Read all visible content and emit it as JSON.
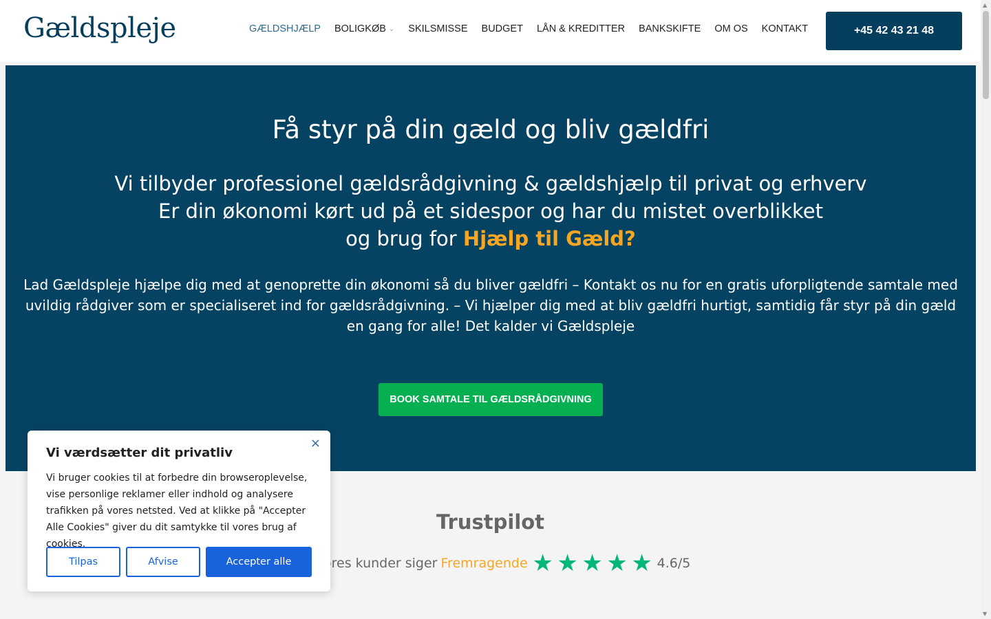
{
  "header": {
    "logo": "Gældspleje",
    "nav": [
      {
        "label": "GÆLDSHJÆLP",
        "active": true
      },
      {
        "label": "BOLIGKØB",
        "has_dropdown": true
      },
      {
        "label": "SKILSMISSE"
      },
      {
        "label": "BUDGET"
      },
      {
        "label": "LÅN & KREDITTER"
      },
      {
        "label": "BANKSKIFTE"
      },
      {
        "label": "OM OS"
      },
      {
        "label": "KONTAKT"
      }
    ],
    "phone": "+45 42 43 21 48"
  },
  "hero": {
    "title": "Få styr på din gæld og bliv gældfri",
    "sub_line1": "Vi tilbyder professionel gældsrådgivning & gældshjælp til privat og erhverv",
    "sub_line2": "Er din økonomi kørt ud på et sidespor og har du mistet overblikket",
    "sub_line3_prefix": "og brug for ",
    "sub_line3_highlight": "Hjælp til Gæld?",
    "body": "Lad Gældspleje hjælpe dig med at genoprette din økonomi så du bliver gældfri – Kontakt os nu for en gratis uforpligtende samtale med uvildig rådgiver som er specialiseret ind for gældsrådgivning. – Vi hjælper dig med at bliv gældfri hurtigt, samtidig får styr på din gæld en gang for alle! Det kalder vi Gældspleje",
    "cta": "BOOK SAMTALE TIL GÆLDSRÅDGIVNING"
  },
  "trustpilot": {
    "title": "Trustpilot",
    "lead": "ores kunder siger",
    "rating_word": "Fremragende",
    "stars": 5,
    "score": "4.6/5"
  },
  "cookie": {
    "title": "Vi værdsætter dit privatliv",
    "text": "Vi bruger cookies til at forbedre din browseroplevelse, vise personlige reklamer eller indhold og analysere trafikken på vores netsted. Ved at klikke på \"Accepter Alle Cookies\" giver du dit samtykke til vores brug af cookies.",
    "customize": "Tilpas",
    "reject": "Afvise",
    "accept": "Accepter alle",
    "close": "×"
  },
  "colors": {
    "brand_navy": "#064362",
    "accent_orange": "#f5a623",
    "cta_green": "#06b050",
    "trustpilot_green": "#00b67a",
    "cookie_blue": "#1863dc"
  }
}
